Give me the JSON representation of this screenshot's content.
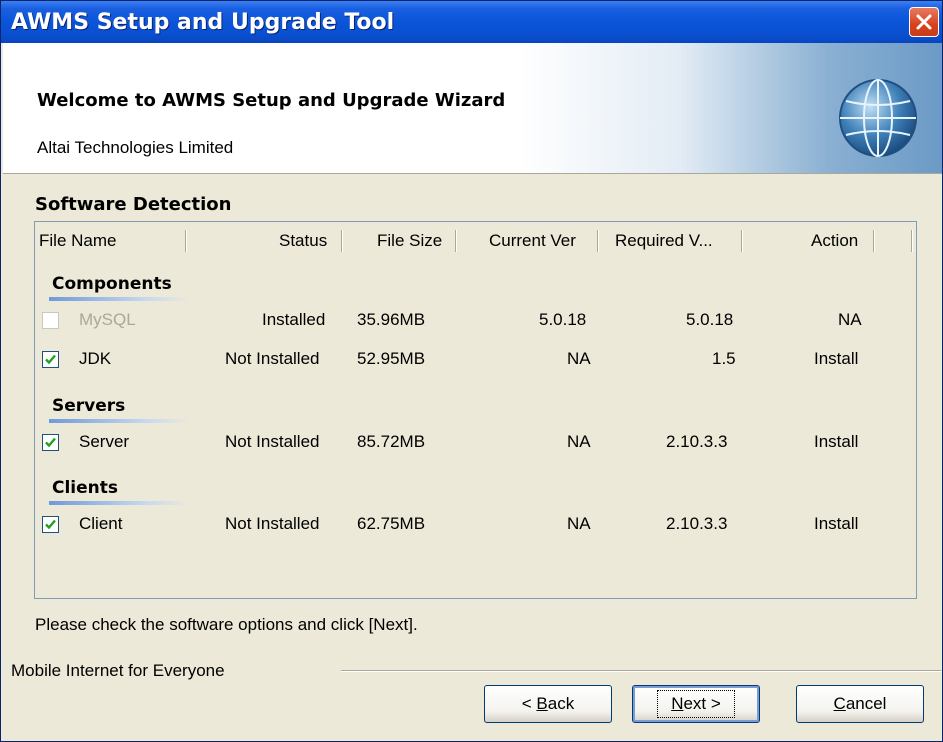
{
  "window": {
    "title": "AWMS Setup and Upgrade Tool"
  },
  "header": {
    "title": "Welcome to AWMS Setup and Upgrade Wizard",
    "subtitle": "Altai Technologies Limited"
  },
  "section_label": "Software Detection",
  "columns": [
    "File Name",
    "Status",
    "File Size",
    "Current Ver",
    "Required V...",
    "Action"
  ],
  "groups": {
    "components": "Components",
    "servers": "Servers",
    "clients": "Clients"
  },
  "rows": {
    "mysql": {
      "name": "MySQL",
      "status": "Installed",
      "size": "35.96MB",
      "current": "5.0.18",
      "required": "5.0.18",
      "action": "NA",
      "checked": false,
      "enabled": false
    },
    "jdk": {
      "name": "JDK",
      "status": "Not Installed",
      "size": "52.95MB",
      "current": "NA",
      "required": "1.5",
      "action": "Install",
      "checked": true,
      "enabled": true
    },
    "server": {
      "name": "Server",
      "status": "Not Installed",
      "size": "85.72MB",
      "current": "NA",
      "required": "2.10.3.3",
      "action": "Install",
      "checked": true,
      "enabled": true
    },
    "client": {
      "name": "Client",
      "status": "Not Installed",
      "size": "62.75MB",
      "current": "NA",
      "required": "2.10.3.3",
      "action": "Install",
      "checked": true,
      "enabled": true
    }
  },
  "hint": "Please check the software options and click [Next].",
  "footer_label": "Mobile Internet for Everyone",
  "buttons": {
    "back_prefix": "< ",
    "back_mnemonic": "B",
    "back_rest": "ack",
    "next_mnemonic": "N",
    "next_rest": "ext >",
    "cancel_mnemonic": "C",
    "cancel_rest": "ancel"
  },
  "colors": {
    "titlebar": "#0b55d9",
    "check": "#21a121",
    "close": "#d8421e"
  }
}
